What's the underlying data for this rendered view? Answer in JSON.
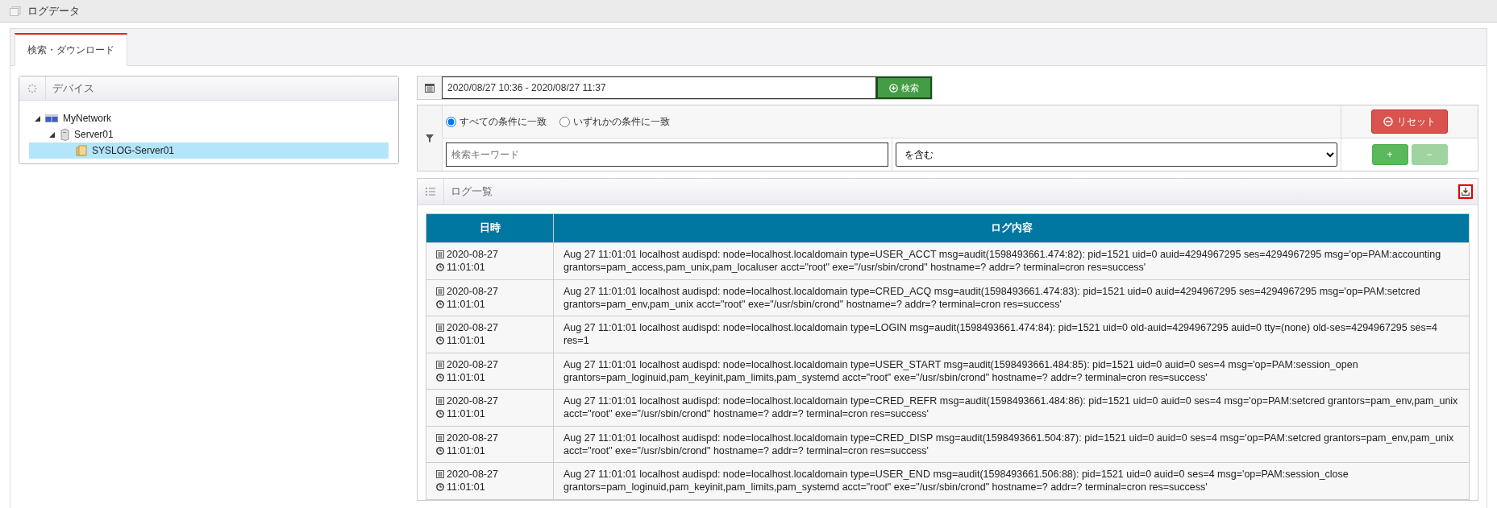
{
  "window": {
    "title": "ログデータ"
  },
  "tabs": [
    {
      "label": "検索・ダウンロード",
      "selected": true
    }
  ],
  "device_panel": {
    "title": "デバイス",
    "tree": [
      {
        "label": "MyNetwork",
        "kind": "network",
        "expanded": true,
        "selected": false,
        "children": [
          {
            "label": "Server01",
            "kind": "server",
            "expanded": true,
            "selected": false,
            "children": [
              {
                "label": "SYSLOG-Server01",
                "kind": "folder",
                "selected": true
              }
            ]
          }
        ]
      }
    ]
  },
  "search": {
    "date_range": "2020/08/27 10:36 - 2020/08/27 11:37",
    "search_button": "検索"
  },
  "filter": {
    "match_options": [
      {
        "label": "すべての条件に一致",
        "selected": true
      },
      {
        "label": "いずれかの条件に一致",
        "selected": false
      }
    ],
    "reset_button": "リセット",
    "keyword": {
      "placeholder": "検索キーワード"
    },
    "condition": "を含む",
    "add_button": {
      "label": "+",
      "disabled": false
    },
    "remove_button": {
      "label": "−",
      "disabled": true
    }
  },
  "log_list": {
    "title": "ログ一覧",
    "columns": [
      "日時",
      "ログ内容"
    ],
    "rows": [
      {
        "date": "2020-08-27",
        "time": "11:01:01",
        "message": "Aug 27 11:01:01 localhost audispd: node=localhost.localdomain type=USER_ACCT msg=audit(1598493661.474:82): pid=1521 uid=0 auid=4294967295 ses=4294967295 msg='op=PAM:accounting grantors=pam_access,pam_unix,pam_localuser acct=\"root\" exe=\"/usr/sbin/crond\" hostname=? addr=? terminal=cron res=success'"
      },
      {
        "date": "2020-08-27",
        "time": "11:01:01",
        "message": "Aug 27 11:01:01 localhost audispd: node=localhost.localdomain type=CRED_ACQ msg=audit(1598493661.474:83): pid=1521 uid=0 auid=4294967295 ses=4294967295 msg='op=PAM:setcred grantors=pam_env,pam_unix acct=\"root\" exe=\"/usr/sbin/crond\" hostname=? addr=? terminal=cron res=success'"
      },
      {
        "date": "2020-08-27",
        "time": "11:01:01",
        "message": "Aug 27 11:01:01 localhost audispd: node=localhost.localdomain type=LOGIN msg=audit(1598493661.474:84): pid=1521 uid=0 old-auid=4294967295 auid=0 tty=(none) old-ses=4294967295 ses=4 res=1"
      },
      {
        "date": "2020-08-27",
        "time": "11:01:01",
        "message": "Aug 27 11:01:01 localhost audispd: node=localhost.localdomain type=USER_START msg=audit(1598493661.484:85): pid=1521 uid=0 auid=0 ses=4 msg='op=PAM:session_open grantors=pam_loginuid,pam_keyinit,pam_limits,pam_systemd acct=\"root\" exe=\"/usr/sbin/crond\" hostname=? addr=? terminal=cron res=success'"
      },
      {
        "date": "2020-08-27",
        "time": "11:01:01",
        "message": "Aug 27 11:01:01 localhost audispd: node=localhost.localdomain type=CRED_REFR msg=audit(1598493661.484:86): pid=1521 uid=0 auid=0 ses=4 msg='op=PAM:setcred grantors=pam_env,pam_unix acct=\"root\" exe=\"/usr/sbin/crond\" hostname=? addr=? terminal=cron res=success'"
      },
      {
        "date": "2020-08-27",
        "time": "11:01:01",
        "message": "Aug 27 11:01:01 localhost audispd: node=localhost.localdomain type=CRED_DISP msg=audit(1598493661.504:87): pid=1521 uid=0 auid=0 ses=4 msg='op=PAM:setcred grantors=pam_env,pam_unix acct=\"root\" exe=\"/usr/sbin/crond\" hostname=? addr=? terminal=cron res=success'"
      },
      {
        "date": "2020-08-27",
        "time": "11:01:01",
        "message": "Aug 27 11:01:01 localhost audispd: node=localhost.localdomain type=USER_END msg=audit(1598493661.506:88): pid=1521 uid=0 auid=0 ses=4 msg='op=PAM:session_close grantors=pam_loginuid,pam_keyinit,pam_limits,pam_systemd acct=\"root\" exe=\"/usr/sbin/crond\" hostname=? addr=? terminal=cron res=success'"
      }
    ]
  }
}
